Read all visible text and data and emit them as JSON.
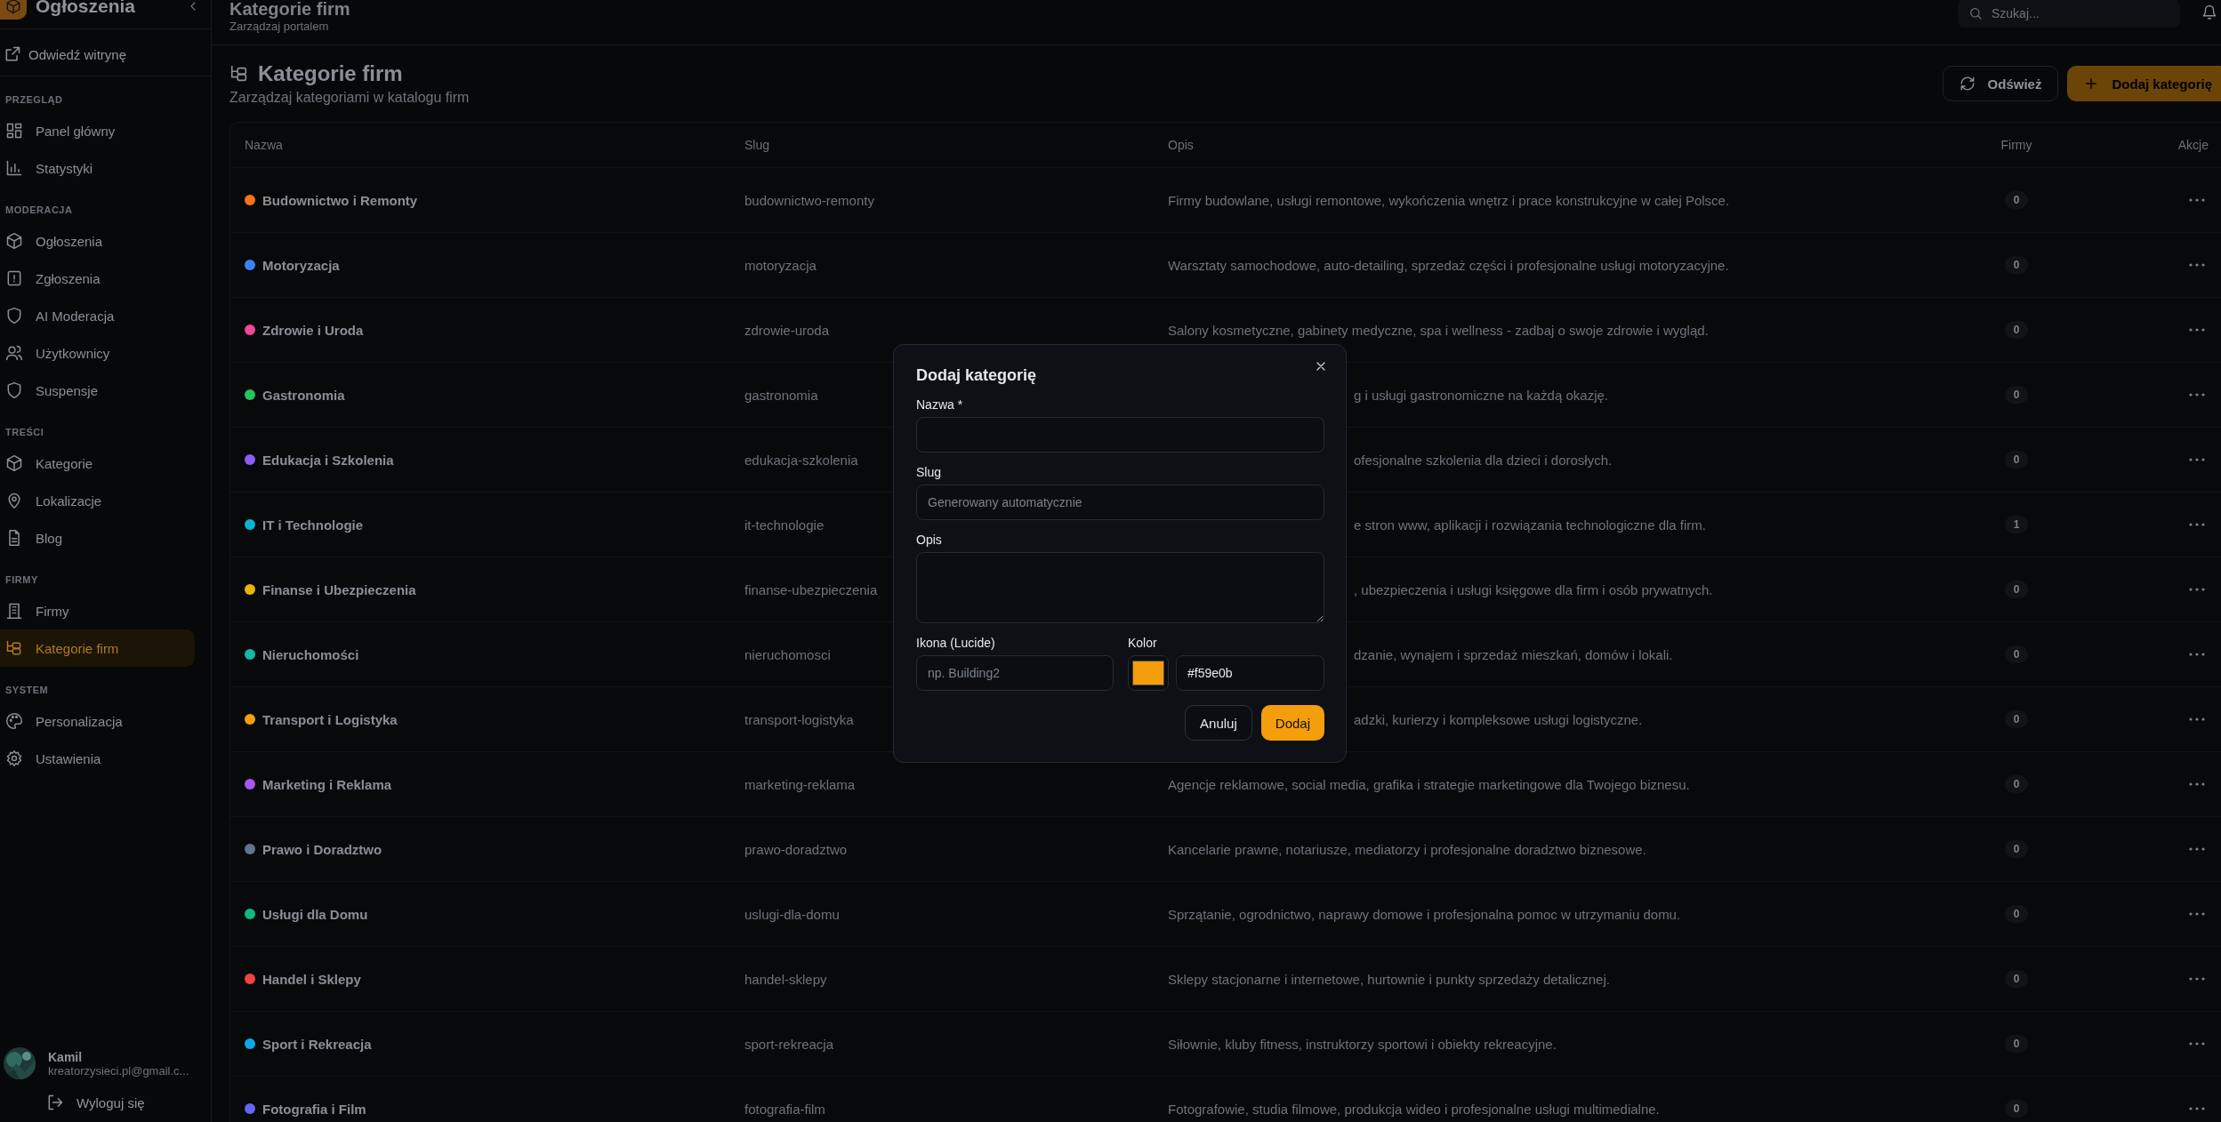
{
  "sidebar": {
    "brand": "Ogłoszenia",
    "visit_link": "Odwiedź witrynę",
    "sections": [
      {
        "title": "PRZEGLĄD",
        "items": [
          {
            "label": "Panel główny",
            "selected": false
          },
          {
            "label": "Statystyki",
            "selected": false
          }
        ]
      },
      {
        "title": "MODERACJA",
        "items": [
          {
            "label": "Ogłoszenia",
            "selected": false
          },
          {
            "label": "Zgłoszenia",
            "selected": false
          },
          {
            "label": "AI Moderacja",
            "selected": false
          },
          {
            "label": "Użytkownicy",
            "selected": false
          },
          {
            "label": "Suspensje",
            "selected": false
          }
        ]
      },
      {
        "title": "TREŚCI",
        "items": [
          {
            "label": "Kategorie",
            "selected": false
          },
          {
            "label": "Lokalizacje",
            "selected": false
          },
          {
            "label": "Blog",
            "selected": false
          }
        ]
      },
      {
        "title": "FIRMY",
        "items": [
          {
            "label": "Firmy",
            "selected": false
          },
          {
            "label": "Kategorie firm",
            "selected": true
          }
        ]
      },
      {
        "title": "SYSTEM",
        "items": [
          {
            "label": "Personalizacja",
            "selected": false
          },
          {
            "label": "Ustawienia",
            "selected": false
          }
        ]
      }
    ],
    "user": {
      "name": "Kamil",
      "email": "kreatorzysieci.pl@gmail.c...",
      "logout": "Wyloguj się"
    }
  },
  "topbar": {
    "title": "Kategorie firm",
    "subtitle": "Zarządzaj portalem",
    "search": {
      "placeholder": "Szukaj..."
    }
  },
  "page": {
    "title": "Kategorie firm",
    "subtitle": "Zarządzaj kategoriami w katalogu firm",
    "buttons": [
      {
        "label": "Odśwież",
        "kind": "outline"
      },
      {
        "label": "Dodaj kategorię",
        "kind": "primary"
      }
    ]
  },
  "table": {
    "columns": [
      "Nazwa",
      "Slug",
      "Opis",
      "Firmy",
      "Akcje"
    ],
    "rows": [
      {
        "name": "Budownictwo i Remonty",
        "color": "#f97316",
        "slug": "budownictwo-remonty",
        "description": "Firmy budowlane, usługi remontowe, wykończenia wnętrz i prace konstrukcyjne w całej Polsce.",
        "kind": "full",
        "companies": "0"
      },
      {
        "name": "Motoryzacja",
        "color": "#3b82f6",
        "slug": "motoryzacja",
        "description": "Warsztaty samochodowe, auto-detailing, sprzedaż części i profesjonalne usługi motoryzacyjne.",
        "kind": "full",
        "companies": "0"
      },
      {
        "name": "Zdrowie i Uroda",
        "color": "#ec4899",
        "slug": "zdrowie-uroda",
        "description": "Salony kosmetyczne, gabinety medyczne, spa i wellness - zadbaj o swoje zdrowie i wygląd.",
        "kind": "full",
        "companies": "0"
      },
      {
        "name": "Gastronomia",
        "color": "#22c55e",
        "slug": "gastronomia",
        "description": "g i usługi gastronomiczne na każdą okazję.",
        "kind": "partial",
        "companies": "0"
      },
      {
        "name": "Edukacja i Szkolenia",
        "color": "#8b5cf6",
        "slug": "edukacja-szkolenia",
        "description": "ofesjonalne szkolenia dla dzieci i dorosłych.",
        "kind": "partial",
        "companies": "0"
      },
      {
        "name": "IT i Technologie",
        "color": "#06b6d4",
        "slug": "it-technologie",
        "description": "e stron www, aplikacji i rozwiązania technologiczne dla firm.",
        "kind": "partial",
        "companies": "1"
      },
      {
        "name": "Finanse i Ubezpieczenia",
        "color": "#eab308",
        "slug": "finanse-ubezpieczenia",
        "description": ", ubezpieczenia i usługi księgowe dla firm i osób prywatnych.",
        "kind": "partial",
        "companies": "0"
      },
      {
        "name": "Nieruchomości",
        "color": "#14b8a6",
        "slug": "nieruchomosci",
        "description": "dzanie, wynajem i sprzedaż mieszkań, domów i lokali.",
        "kind": "partial",
        "companies": "0"
      },
      {
        "name": "Transport i Logistyka",
        "color": "#f59e0b",
        "slug": "transport-logistyka",
        "description": "adzki, kurierzy i kompleksowe usługi logistyczne.",
        "kind": "partial",
        "companies": "0"
      },
      {
        "name": "Marketing i Reklama",
        "color": "#a855f7",
        "slug": "marketing-reklama",
        "description": "Agencje reklamowe, social media, grafika i strategie marketingowe dla Twojego biznesu.",
        "kind": "full",
        "companies": "0"
      },
      {
        "name": "Prawo i Doradztwo",
        "color": "#64748b",
        "slug": "prawo-doradztwo",
        "description": "Kancelarie prawne, notariusze, mediatorzy i profesjonalne doradztwo biznesowe.",
        "kind": "full",
        "companies": "0"
      },
      {
        "name": "Usługi dla Domu",
        "color": "#10b981",
        "slug": "uslugi-dla-domu",
        "description": "Sprzątanie, ogrodnictwo, naprawy domowe i profesjonalna pomoc w utrzymaniu domu.",
        "kind": "full",
        "companies": "0"
      },
      {
        "name": "Handel i Sklepy",
        "color": "#ef4444",
        "slug": "handel-sklepy",
        "description": "Sklepy stacjonarne i internetowe, hurtownie i punkty sprzedaży detalicznej.",
        "kind": "full",
        "companies": "0"
      },
      {
        "name": "Sport i Rekreacja",
        "color": "#0ea5e9",
        "slug": "sport-rekreacja",
        "description": "Siłownie, kluby fitness, instruktorzy sportowi i obiekty rekreacyjne.",
        "kind": "full",
        "companies": "0"
      },
      {
        "name": "Fotografia i Film",
        "color": "#6366f1",
        "slug": "fotografia-film",
        "description": "Fotografowie, studia filmowe, produkcja wideo i profesjonalne usługi multimedialne.",
        "kind": "full",
        "companies": "0"
      }
    ]
  },
  "dialog": {
    "title": "Dodaj kategorię",
    "fields": [
      {
        "label": "Nazwa *",
        "kind": "input"
      },
      {
        "label": "Slug",
        "kind": "input",
        "placeholder": "Generowany automatycznie"
      },
      {
        "label": "Opis",
        "kind": "textarea"
      }
    ],
    "icon_field": {
      "label": "Ikona (Lucide)",
      "placeholder": "np. Building2"
    },
    "color_field": {
      "label": "Kolor",
      "color": "#f59e0b",
      "value": "#f59e0b"
    },
    "buttons": [
      {
        "label": "Anuluj",
        "kind": "outline"
      },
      {
        "label": "Dodaj",
        "kind": "primary"
      }
    ]
  }
}
